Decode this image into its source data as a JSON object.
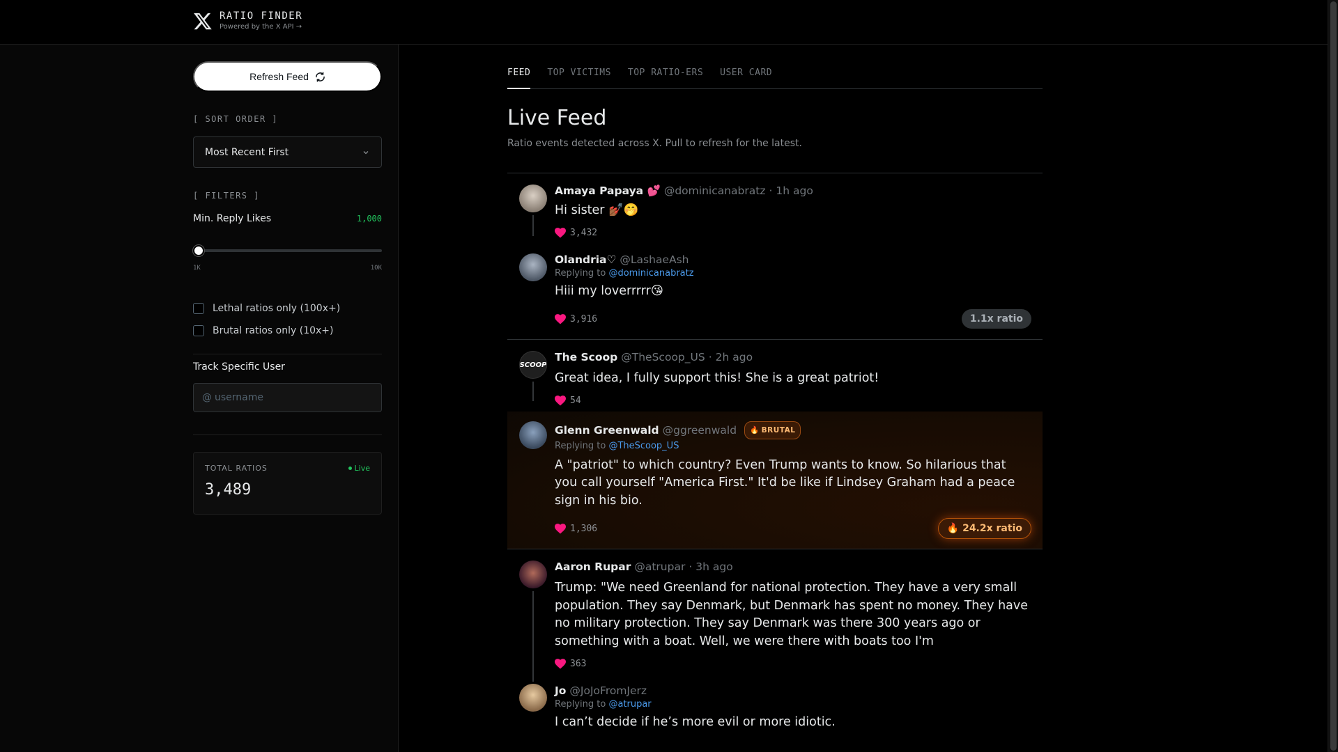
{
  "header": {
    "title": "RATIO FINDER",
    "subtitle": "Powered by the X API →"
  },
  "sidebar": {
    "refresh_label": "Refresh Feed",
    "sort_label": "[ SORT ORDER ]",
    "sort_value": "Most Recent First",
    "filters_label": "[ FILTERS ]",
    "min_likes_label": "Min. Reply Likes",
    "min_likes_value": "1,000",
    "slider_level": 0.0,
    "slider_min_label": "1K",
    "slider_max_label": "10K",
    "lethal_label": "Lethal ratios only (100x+)",
    "brutal_label": "Brutal ratios only (10x+)",
    "track_label": "Track Specific User",
    "track_prefix": "@",
    "track_placeholder": "username",
    "total_label": "TOTAL RATIOS",
    "live_label": "Live",
    "total_value": "3,489"
  },
  "tabs": [
    "FEED",
    "TOP VICTIMS",
    "TOP RATIO-ERS",
    "USER CARD"
  ],
  "main": {
    "title": "Live Feed",
    "subtitle": "Ratio events detected across X. Pull to refresh for the latest."
  },
  "feed": [
    {
      "original": {
        "name": "Amaya Papaya 💕",
        "handle": "@dominicanabratz",
        "time": "1h ago",
        "text": "Hi sister 💅🏾🤭",
        "likes": "3,432",
        "avatar_color": "#9a8f84"
      },
      "reply": {
        "name": "Olandria♡",
        "handle": "@LashaeAsh",
        "replying_prefix": "Replying to",
        "replying_to": "@dominicanabratz",
        "text": "Hiii my loverrrrr😘",
        "likes": "3,916",
        "ratio": "1.1x ratio",
        "avatar_color": "#6d7a8e"
      }
    },
    {
      "original": {
        "name": "The Scoop",
        "handle": "@TheScoop_US",
        "time": "2h ago",
        "text": "Great idea, I fully support this! She is a great patriot!",
        "likes": "54",
        "avatar_color": "#222222"
      },
      "reply": {
        "name": "Glenn Greenwald",
        "handle": "@ggreenwald",
        "badge": "BRUTAL",
        "replying_prefix": "Replying to",
        "replying_to": "@TheScoop_US",
        "text": "A \"patriot\" to which country? Even Trump wants to know. So hilarious that you call yourself \"America First.\" It'd be like if Lindsey Graham had a peace sign in his bio.",
        "likes": "1,306",
        "ratio": "24.2x ratio",
        "avatar_color": "#5b6f88"
      }
    },
    {
      "original": {
        "name": "Aaron Rupar",
        "handle": "@atrupar",
        "time": "3h ago",
        "text": "Trump: \"We need Greenland for national protection. They have a very small population. They say Denmark, but Denmark has spent no money. They have no military protection. They say Denmark was there 300 years ago or something with a boat. Well, we were there with boats too I'm",
        "likes": "363",
        "avatar_color": "#5a2a3a"
      },
      "reply": {
        "name": "Jo",
        "handle": "@JoJoFromJerz",
        "replying_prefix": "Replying to",
        "replying_to": "@atrupar",
        "text": "I can’t decide if he’s more evil or more idiotic.",
        "avatar_color": "#c9a27a"
      }
    }
  ],
  "colors": {
    "accent_live": "#22c55e",
    "link": "#4a99e9",
    "heart": "#f91880",
    "brutal": "#fdba74"
  },
  "icons": [
    "x-logo-icon",
    "refresh-icon",
    "chevron-down-icon",
    "heart-icon",
    "fire-icon"
  ]
}
